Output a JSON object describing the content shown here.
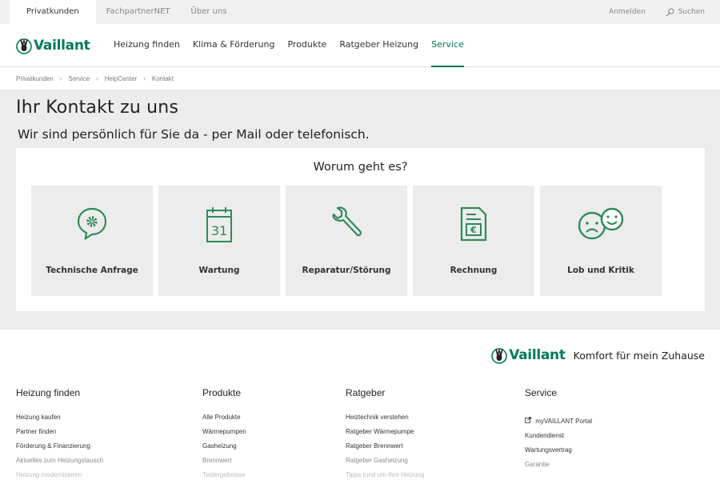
{
  "topbar": {
    "tabs": [
      "Privatkunden",
      "FachpartnerNET",
      "Über uns"
    ],
    "login": "Anmelden",
    "search": "Suchen"
  },
  "brand": {
    "name": "Vaillant",
    "color": "#007a5a"
  },
  "nav": {
    "items": [
      "Heizung finden",
      "Klima & Förderung",
      "Produkte",
      "Ratgeber Heizung",
      "Service"
    ],
    "active": "Service"
  },
  "breadcrumb": [
    "Privatkunden",
    "Service",
    "HelpCenter",
    "Kontakt"
  ],
  "main": {
    "title": "Ihr Kontakt zu uns",
    "subtitle": "Wir sind persönlich für Sie da - per Mail oder telefonisch.",
    "question": "Worum geht es?",
    "tiles": [
      {
        "label": "Technische Anfrage",
        "icon": "speech-bubble-gear-icon"
      },
      {
        "label": "Wartung",
        "icon": "calendar-31-icon"
      },
      {
        "label": "Reparatur/Störung",
        "icon": "wrench-icon"
      },
      {
        "label": "Rechnung",
        "icon": "invoice-euro-icon"
      },
      {
        "label": "Lob und Kritik",
        "icon": "sad-happy-faces-icon"
      }
    ]
  },
  "footer": {
    "slogan": "Komfort für mein Zuhause",
    "columns": [
      {
        "title": "Heizung finden",
        "links": [
          "Heizung kaufen",
          "Partner finden",
          "Förderung & Finanzierung",
          "Aktuelles zum Heizungstausch",
          "Heizung modernisieren"
        ]
      },
      {
        "title": "Produkte",
        "links": [
          "Alle Produkte",
          "Wärmepumpen",
          "Gasheizung",
          "Brennwert",
          "Testergebnisse"
        ]
      },
      {
        "title": "Ratgeber",
        "links": [
          "Heiztechnik verstehen",
          "Ratgeber Wärmepumpe",
          "Ratgeber Brennwert",
          "Ratgeber Gasheizung",
          "Tipps rund um Ihre Heizung"
        ]
      },
      {
        "title": "Service",
        "links": [
          "myVAILLANT Portal",
          "Kundendienst",
          "Wartungsvertrag",
          "Garantie"
        ]
      }
    ]
  }
}
